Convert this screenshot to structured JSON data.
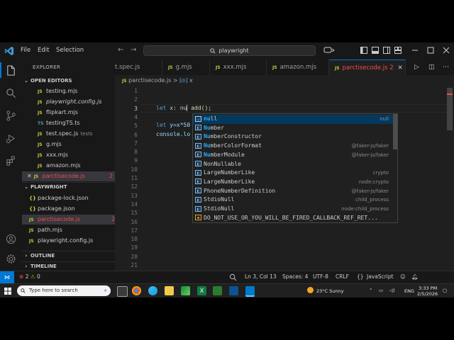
{
  "titlebar": {
    "menu": [
      "File",
      "Edit",
      "Selection"
    ],
    "nav_back": "←",
    "nav_forward": "→",
    "command_center": "playwright"
  },
  "sidebar": {
    "title": "EXPLORER",
    "open_editors_label": "OPEN EDITORS",
    "open_editors": [
      {
        "icon": "JS",
        "name": "testing.mjs",
        "note": "",
        "badge": ""
      },
      {
        "icon": "JS",
        "name": "playwright.config.js",
        "note": "",
        "badge": ""
      },
      {
        "icon": "JS",
        "name": "flipkart.mjs",
        "note": "",
        "badge": ""
      },
      {
        "icon": "TS",
        "name": "testingTS.ts",
        "note": "",
        "badge": ""
      },
      {
        "icon": "JS",
        "name": "test.spec.js",
        "note": "tests",
        "badge": ""
      },
      {
        "icon": "JS",
        "name": "g.mjs",
        "note": "",
        "badge": ""
      },
      {
        "icon": "JS",
        "name": "xxx.mjs",
        "note": "",
        "badge": ""
      },
      {
        "icon": "JS",
        "name": "amazon.mjs",
        "note": "",
        "badge": ""
      },
      {
        "icon": "JS",
        "name": "parctisecode.js",
        "note": "",
        "badge": "2"
      }
    ],
    "project_label": "PLAYWRIGHT",
    "project_files": [
      {
        "icon": "{}",
        "name": "package-lock.json",
        "badge": ""
      },
      {
        "icon": "{}",
        "name": "package.json",
        "badge": ""
      },
      {
        "icon": "JS",
        "name": "parctisecode.js",
        "badge": "2"
      },
      {
        "icon": "JS",
        "name": "path.mjs",
        "badge": ""
      },
      {
        "icon": "JS",
        "name": "playwright.config.js",
        "badge": ""
      }
    ],
    "outline_label": "OUTLINE",
    "timeline_label": "TIMELINE"
  },
  "tabs": [
    {
      "name": "t.spec.js",
      "badge": ""
    },
    {
      "name": "g.mjs",
      "badge": ""
    },
    {
      "name": "xxx.mjs",
      "badge": ""
    },
    {
      "name": "amazon.mjs",
      "badge": ""
    },
    {
      "name": "parctisecode.js",
      "badge": "2"
    }
  ],
  "breadcrumb": {
    "file": "parctisecode.js",
    "separator": ">",
    "symbol": "x"
  },
  "editor": {
    "line_numbers": [
      "1",
      "2",
      "3",
      "4",
      "5",
      "6",
      "7",
      "8",
      "9",
      "10",
      "11",
      "12",
      "13",
      "14",
      "15",
      "16",
      "17",
      "18",
      "19",
      "20",
      "21"
    ],
    "current_line": "3",
    "line3": {
      "kw": "let",
      "var": "x",
      "rest": ": nu",
      "after": " add();"
    },
    "line5": {
      "kw": "let",
      "text": " y=x*50"
    },
    "line6": {
      "text": "console.lo"
    }
  },
  "suggestions": [
    {
      "kind": "keyword",
      "match": "nu",
      "label": "null",
      "rest": "ll",
      "detail": "null"
    },
    {
      "kind": "class",
      "match": "Nu",
      "label": "Number",
      "rest": "mber",
      "detail": ""
    },
    {
      "kind": "class",
      "match": "Nu",
      "label": "NumberConstructor",
      "rest": "mberConstructor",
      "detail": ""
    },
    {
      "kind": "class",
      "match": "Nu",
      "label": "NumberColorFormat",
      "rest": "mberColorFormat",
      "detail": "@faker-js/faker"
    },
    {
      "kind": "class",
      "match": "Nu",
      "label": "NumberModule",
      "rest": "mberModule",
      "detail": "@faker-js/faker"
    },
    {
      "kind": "class",
      "match": "",
      "label": "NonNullable",
      "rest": "NonNullable",
      "detail": ""
    },
    {
      "kind": "class",
      "match": "",
      "label": "LargeNumberLike",
      "rest": "LargeNumberLike",
      "detail": "crypto"
    },
    {
      "kind": "class",
      "match": "",
      "label": "LargeNumberLike",
      "rest": "LargeNumberLike",
      "detail": "node:crypto"
    },
    {
      "kind": "class",
      "match": "",
      "label": "PhoneNumberDefinition",
      "rest": "PhoneNumberDefinition",
      "detail": "@faker-js/faker"
    },
    {
      "kind": "class",
      "match": "",
      "label": "StdioNull",
      "rest": "StdioNull",
      "detail": "child_process"
    },
    {
      "kind": "class",
      "match": "",
      "label": "StdioNull",
      "rest": "StdioNull",
      "detail": "node:child_process"
    },
    {
      "kind": "prop",
      "match": "",
      "label": "DO_NOT_USE_OR_YOU_WILL_BE_FIRED_CALLBACK_REF_RET...",
      "rest": "DO_NOT_USE_OR_YOU_WILL_BE_FIRED_CALLBACK_REF_RET...",
      "detail": ""
    }
  ],
  "statusbar": {
    "errors": "2",
    "warnings": "0",
    "position": "Ln 3, Col 13",
    "spaces": "Spaces: 4",
    "encoding": "UTF-8",
    "eol": "CRLF",
    "language": "JavaScript"
  },
  "taskbar": {
    "search_placeholder": "Type here to search",
    "weather": "23°C  Sunny",
    "lang": "ENG",
    "time": "3:33 PM",
    "date": "2/5/2026"
  },
  "colors": {
    "accent": "#0078d4",
    "error": "#f14c4c",
    "warning_badge": "#e2c08d",
    "selection": "#04395e"
  }
}
